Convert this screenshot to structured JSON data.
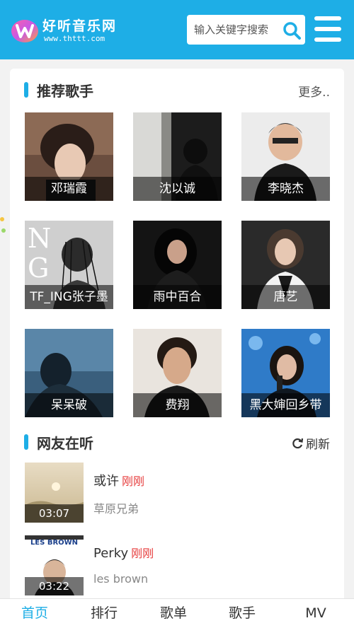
{
  "header": {
    "logo_title": "好听音乐网",
    "logo_url": "www.thttt.com",
    "search_placeholder": "输入关键字搜索",
    "brand_color": "#1eaee6"
  },
  "singers_section": {
    "title": "推荐歌手",
    "more_label": "更多..",
    "singers": [
      {
        "name": "邓瑞霞"
      },
      {
        "name": "沈以诚"
      },
      {
        "name": "李晓杰"
      },
      {
        "name": "TF_ING张子墨"
      },
      {
        "name": "雨中百合"
      },
      {
        "name": "唐艺"
      },
      {
        "name": "呆呆破"
      },
      {
        "name": "费翔"
      },
      {
        "name": "黑大婶回乡带"
      }
    ]
  },
  "listening_section": {
    "title": "网友在听",
    "refresh_label": "刷新",
    "songs": [
      {
        "title": "或许",
        "tag": "刚刚",
        "artist": "草原兄弟",
        "duration": "03:07"
      },
      {
        "title": "Perky",
        "tag": "刚刚",
        "artist": "les brown",
        "duration": "03:22",
        "cover_text": "LES BROWN"
      }
    ]
  },
  "tabbar": {
    "tabs": [
      {
        "label": "首页",
        "active": true
      },
      {
        "label": "排行",
        "active": false
      },
      {
        "label": "歌单",
        "active": false
      },
      {
        "label": "歌手",
        "active": false
      },
      {
        "label": "MV",
        "active": false
      }
    ]
  }
}
